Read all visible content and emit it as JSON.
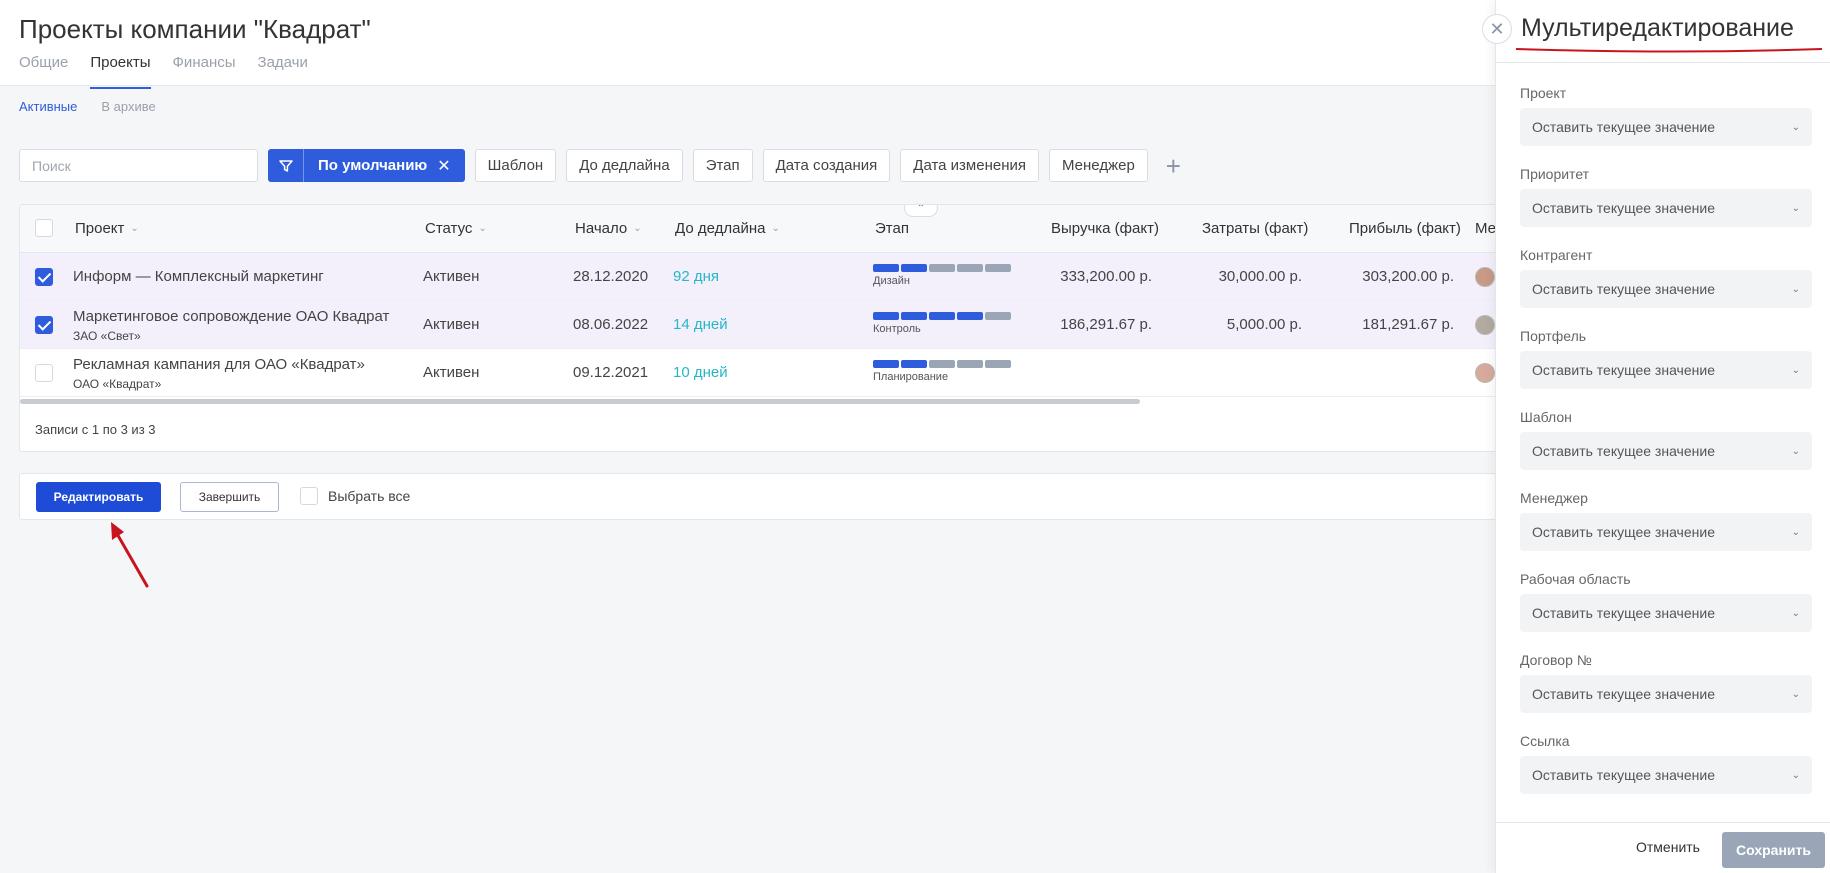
{
  "page": {
    "title": "Проекты компании \"Квадрат\""
  },
  "tabs": [
    {
      "label": "Общие"
    },
    {
      "label": "Проекты",
      "active": true
    },
    {
      "label": "Финансы"
    },
    {
      "label": "Задачи"
    }
  ],
  "subtabs": [
    {
      "label": "Активные",
      "active": true
    },
    {
      "label": "В архиве"
    }
  ],
  "filters": {
    "search_placeholder": "Поиск",
    "active_filter": "По умолчанию",
    "chips": [
      "Шаблон",
      "До дедлайна",
      "Этап",
      "Дата создания",
      "Дата изменения",
      "Менеджер"
    ]
  },
  "table": {
    "columns": [
      "Проект",
      "Статус",
      "Начало",
      "До дедлайна",
      "Этап",
      "Выручка (факт)",
      "Затраты (факт)",
      "Прибыль (факт)",
      "Ме"
    ],
    "rows": [
      {
        "selected": true,
        "project": "Информ — Комплексный маркетинг",
        "client": "",
        "status": "Активен",
        "start": "28.12.2020",
        "deadline": "92 дня",
        "stage": "Дизайн",
        "stage_done": 2,
        "revenue": "333,200.00 р.",
        "costs": "30,000.00 р.",
        "profit": "303,200.00 р."
      },
      {
        "selected": true,
        "project": "Маркетинговое сопровождение ОАО Квадрат",
        "client": "ЗАО «Свет»",
        "status": "Активен",
        "start": "08.06.2022",
        "deadline": "14 дней",
        "stage": "Контроль",
        "stage_done": 4,
        "revenue": "186,291.67 р.",
        "costs": "5,000.00 р.",
        "profit": "181,291.67 р."
      },
      {
        "selected": false,
        "project": "Рекламная кампания для ОАО «Квадрат»",
        "client": "ОАО «Квадрат»",
        "status": "Активен",
        "start": "09.12.2021",
        "deadline": "10 дней",
        "stage": "Планирование",
        "stage_done": 2,
        "revenue": "",
        "costs": "",
        "profit": ""
      }
    ],
    "records_text": "Записи с 1 по 3 из 3"
  },
  "actions": {
    "edit": "Редактировать",
    "finish": "Завершить",
    "select_all": "Выбрать все"
  },
  "panel": {
    "title": "Мультиредактирование",
    "fields": [
      {
        "label": "Проект",
        "value": "Оставить текущее значение"
      },
      {
        "label": "Приоритет",
        "value": "Оставить текущее значение"
      },
      {
        "label": "Контрагент",
        "value": "Оставить текущее значение"
      },
      {
        "label": "Портфель",
        "value": "Оставить текущее значение"
      },
      {
        "label": "Шаблон",
        "value": "Оставить текущее значение"
      },
      {
        "label": "Менеджер",
        "value": "Оставить текущее значение"
      },
      {
        "label": "Рабочая область",
        "value": "Оставить текущее значение"
      },
      {
        "label": "Договор №",
        "value": "Оставить текущее значение"
      },
      {
        "label": "Ссылка",
        "value": "Оставить текущее значение"
      }
    ],
    "cancel": "Отменить",
    "save": "Сохранить"
  },
  "colors": {
    "accent": "#2f5cdc",
    "annotation": "#c8141e",
    "deadline": "#26b6c7"
  }
}
